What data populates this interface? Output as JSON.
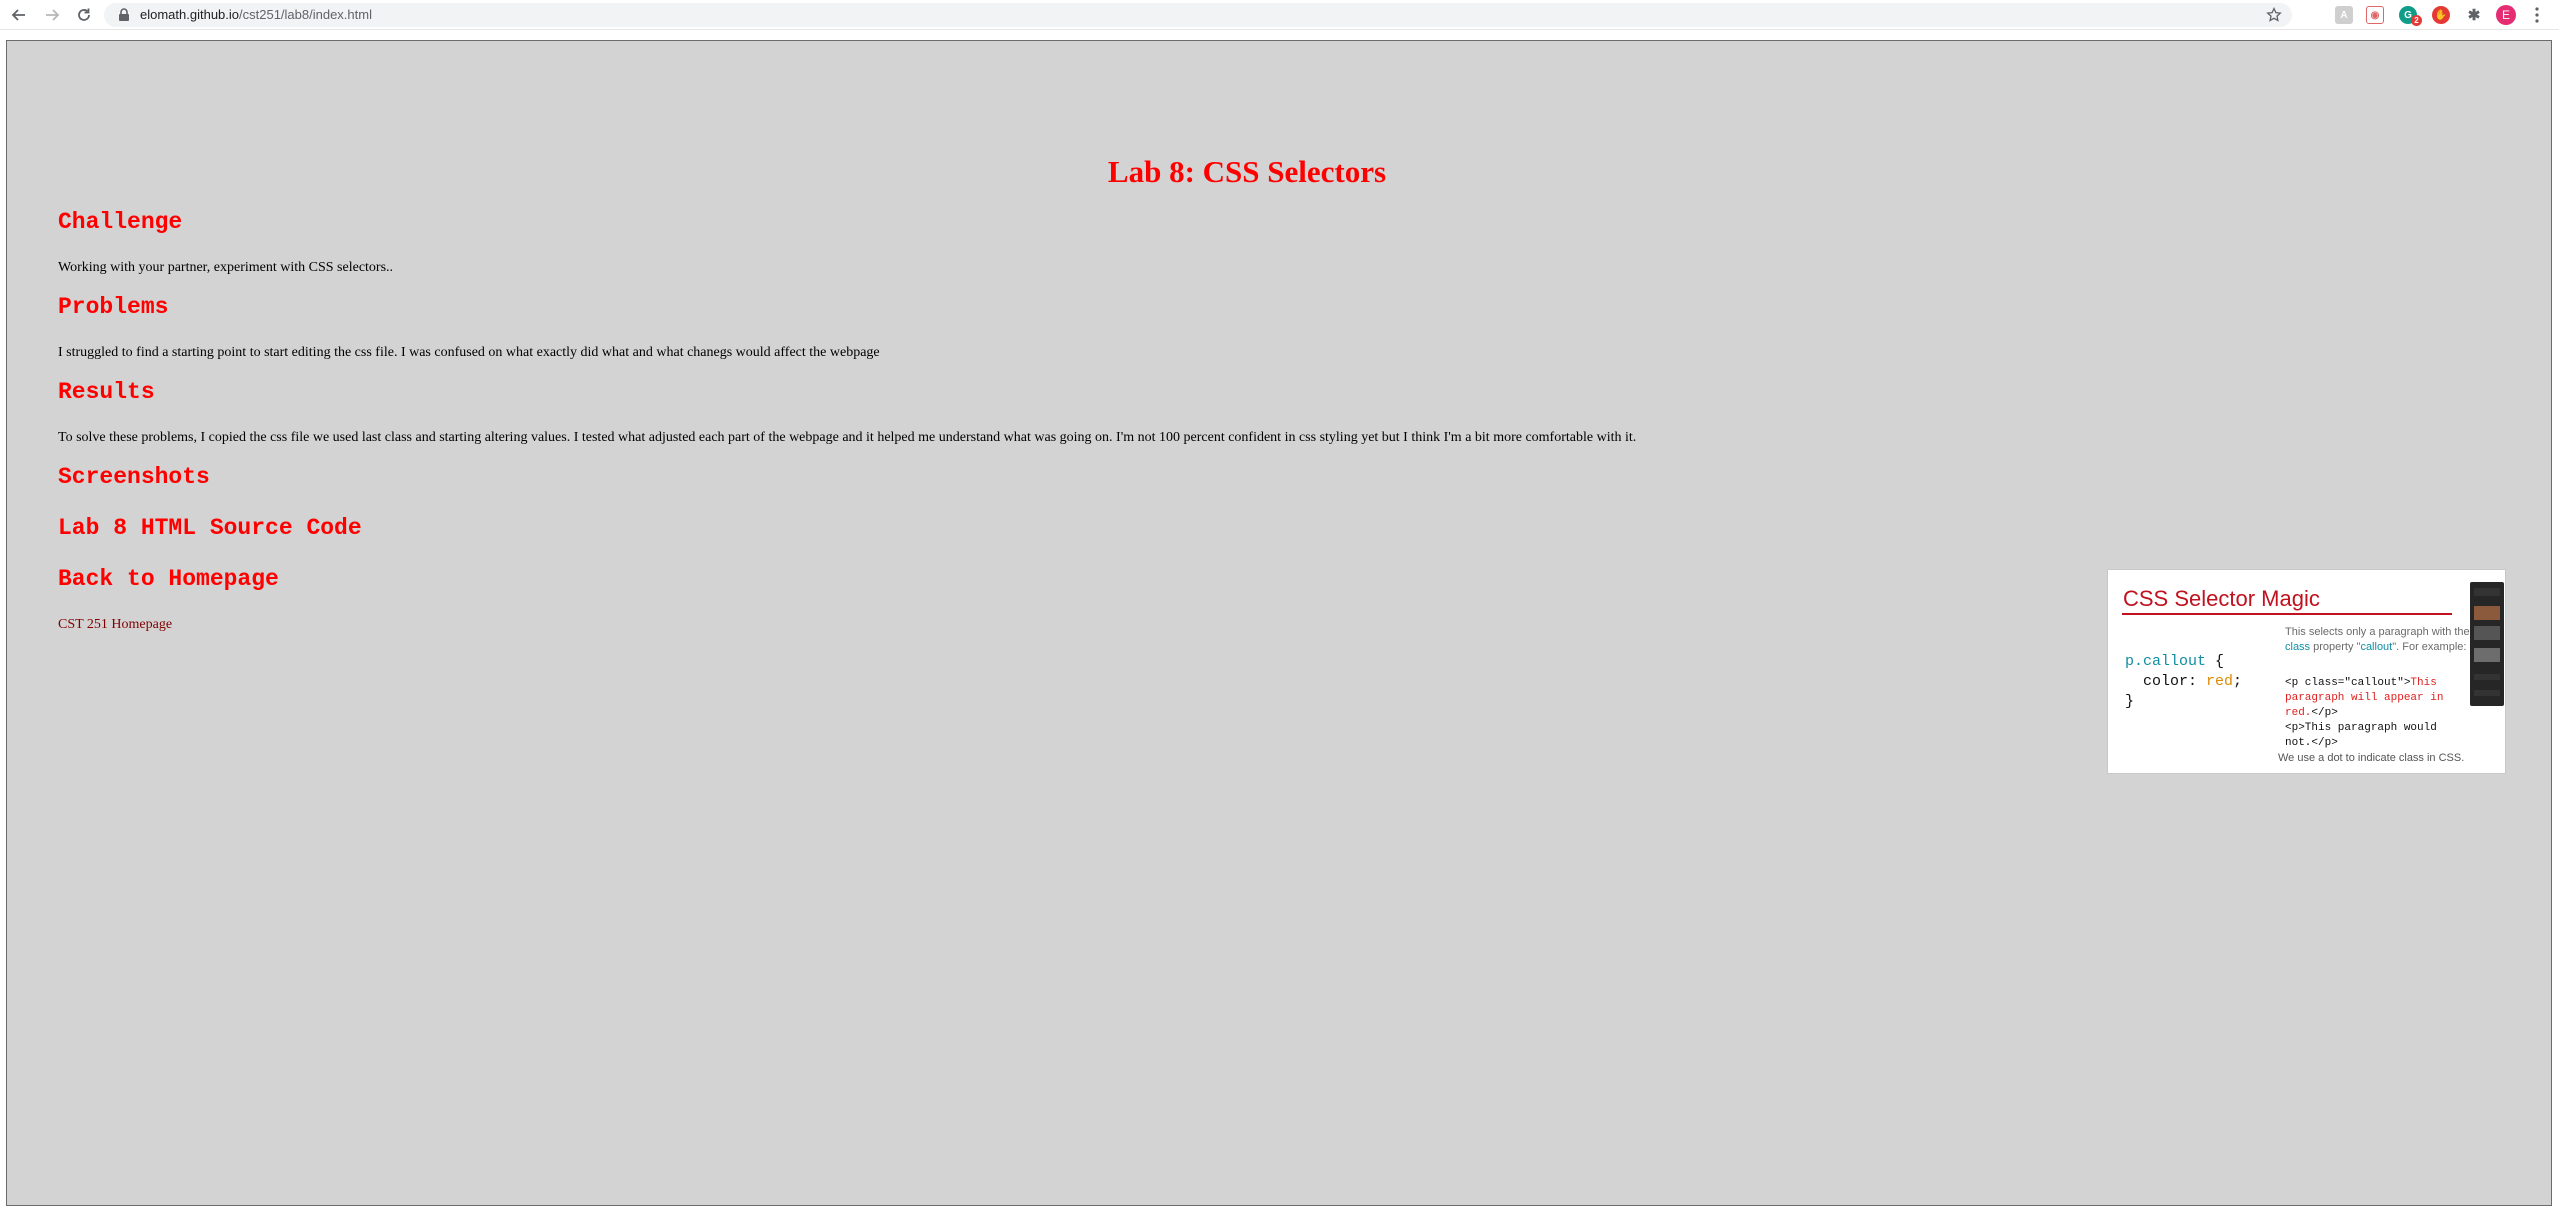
{
  "browser": {
    "url_host": "elomath.github.io",
    "url_path": "/cst251/lab8/index.html",
    "profile_initial": "E",
    "ext_badge_count": "2"
  },
  "page": {
    "title": "Lab 8: CSS Selectors",
    "sections": {
      "challenge": {
        "heading": "Challenge",
        "text": "Working with your partner, experiment with CSS selectors.."
      },
      "problems": {
        "heading": "Problems",
        "text": "I struggled to find a starting point to start editing the css file. I was confused on what exactly did what and what chanegs would affect the webpage"
      },
      "results": {
        "heading": "Results",
        "text": "To solve these problems, I copied the css file we used last class and starting altering values. I tested what adjusted each part of the webpage and it helped me understand what was going on. I'm not 100 percent confident in css styling yet but I think I'm a bit more comfortable with it."
      },
      "screenshots": {
        "heading": "Screenshots"
      },
      "source": {
        "heading": "Lab 8 HTML Source Code"
      },
      "back": {
        "heading": "Back to Homepage",
        "link": "CST 251 Homepage"
      }
    }
  },
  "video_thumbnail": {
    "title": "CSS Selector Magic",
    "code_selector": "p.callout",
    "code_open": " {",
    "code_prop": "color: ",
    "code_value": "red",
    "code_semicolon": ";",
    "code_close": "}",
    "desc_before": "This selects only a paragraph with the ",
    "desc_class": "class",
    "desc_mid": " property \"",
    "desc_callout": "callout",
    "desc_after": "\". For example:",
    "example_open": "<p class=\"callout\">",
    "example_red": "This paragraph will appear in red.",
    "example_close": "</p>",
    "example_line2": "<p>This paragraph would not.</p>",
    "footer": "We use a dot to indicate class in CSS."
  }
}
